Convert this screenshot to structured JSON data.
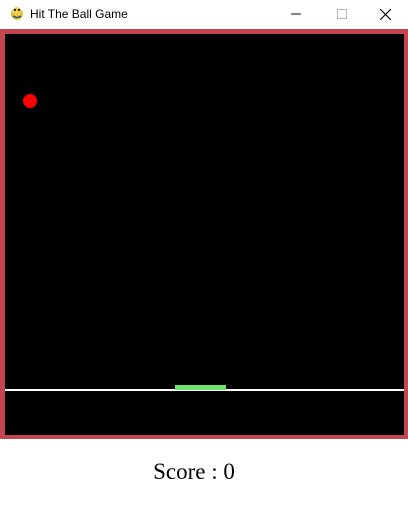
{
  "window": {
    "title": "Hit The Ball Game",
    "icon": "python-snake-icon",
    "controls": [
      "minimize",
      "maximize",
      "close"
    ]
  },
  "game": {
    "frame_color": "#c44450",
    "background_color": "#000000",
    "ball_color": "#ff0000",
    "paddle_color": "#6ee26e",
    "floor_line_color": "#ffffff"
  },
  "score": {
    "label": "Score : 0"
  }
}
